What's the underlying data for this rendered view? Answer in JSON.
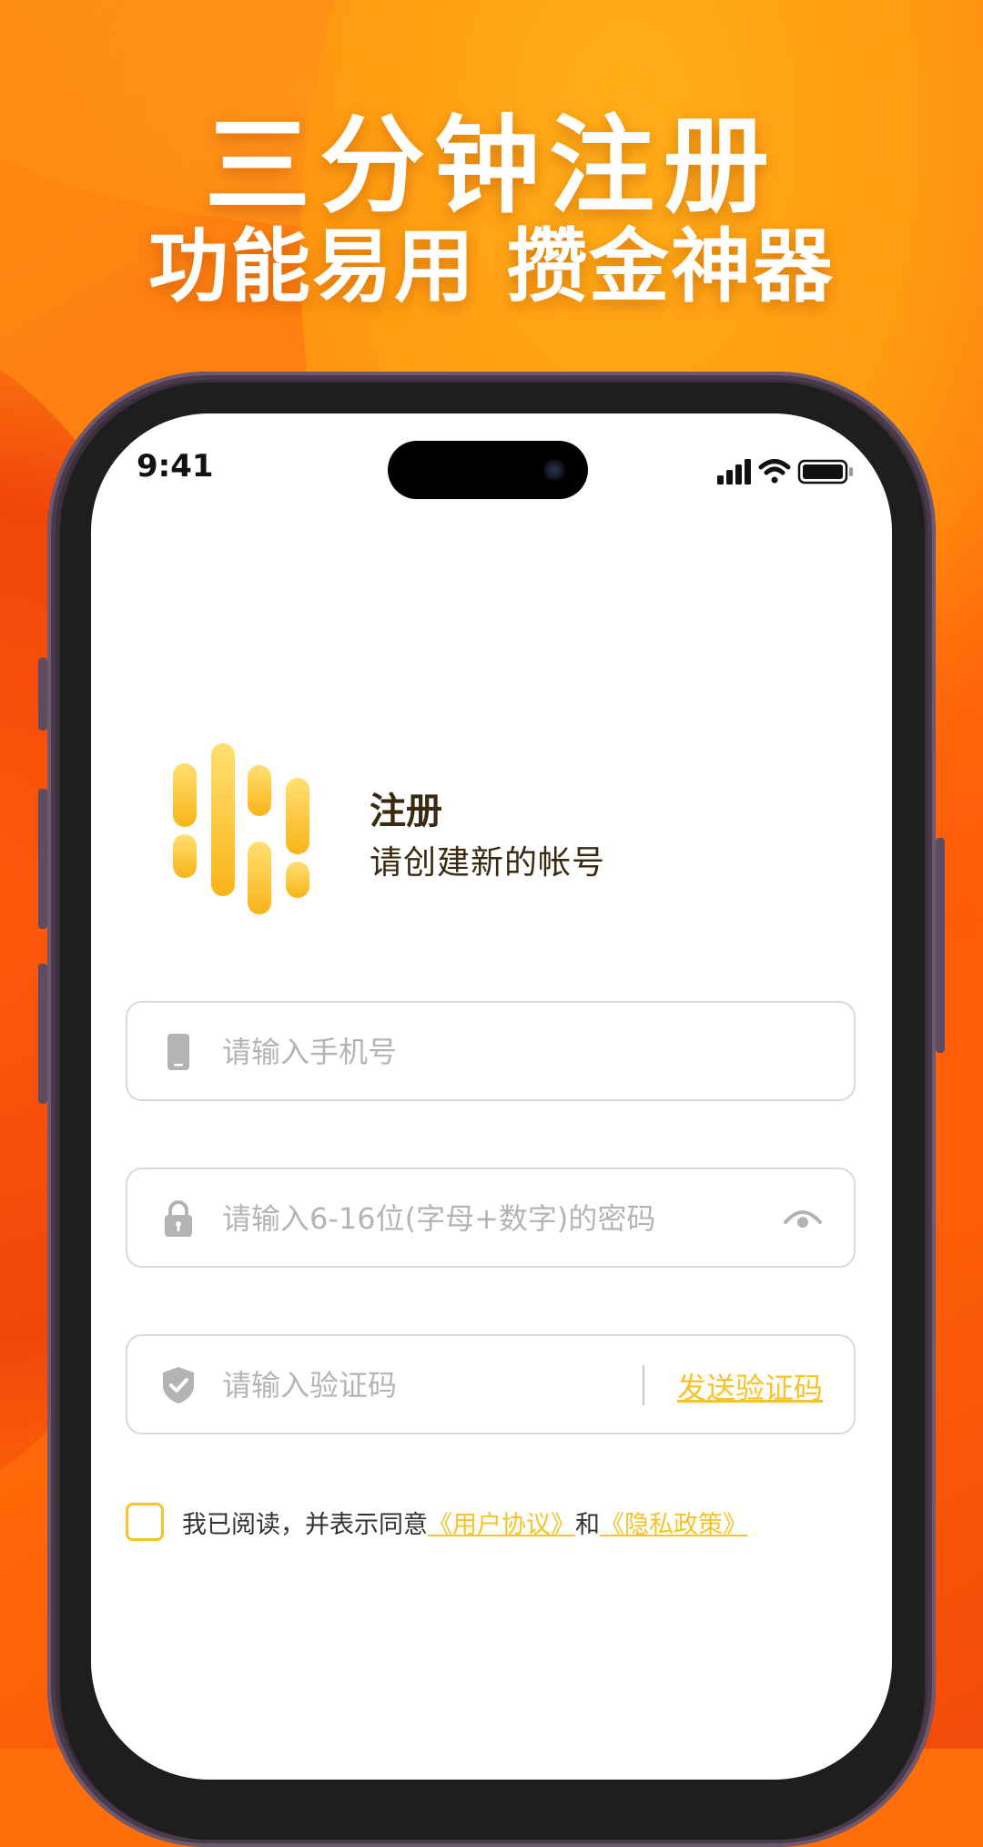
{
  "promo": {
    "headline": "三分钟注册",
    "subheadline_left": "功能易用",
    "subheadline_right": "攒金神器"
  },
  "status_bar": {
    "time": "9:41",
    "icons": [
      "cellular-signal-icon",
      "wifi-icon",
      "battery-icon"
    ]
  },
  "register": {
    "title": "注册",
    "subtitle": "请创建新的帐号",
    "phone_placeholder": "请输入手机号",
    "password_placeholder": "请输入6-16位(字母+数字)的密码",
    "code_placeholder": "请输入验证码",
    "send_code_label": "发送验证码",
    "agreement_prefix": "我已阅读，并表示同意",
    "user_agreement": "《用户协议》",
    "agreement_and": "和",
    "privacy_policy": "《隐私政策》"
  },
  "colors": {
    "accent": "#f7c22a",
    "background": "#ff7a0e"
  }
}
